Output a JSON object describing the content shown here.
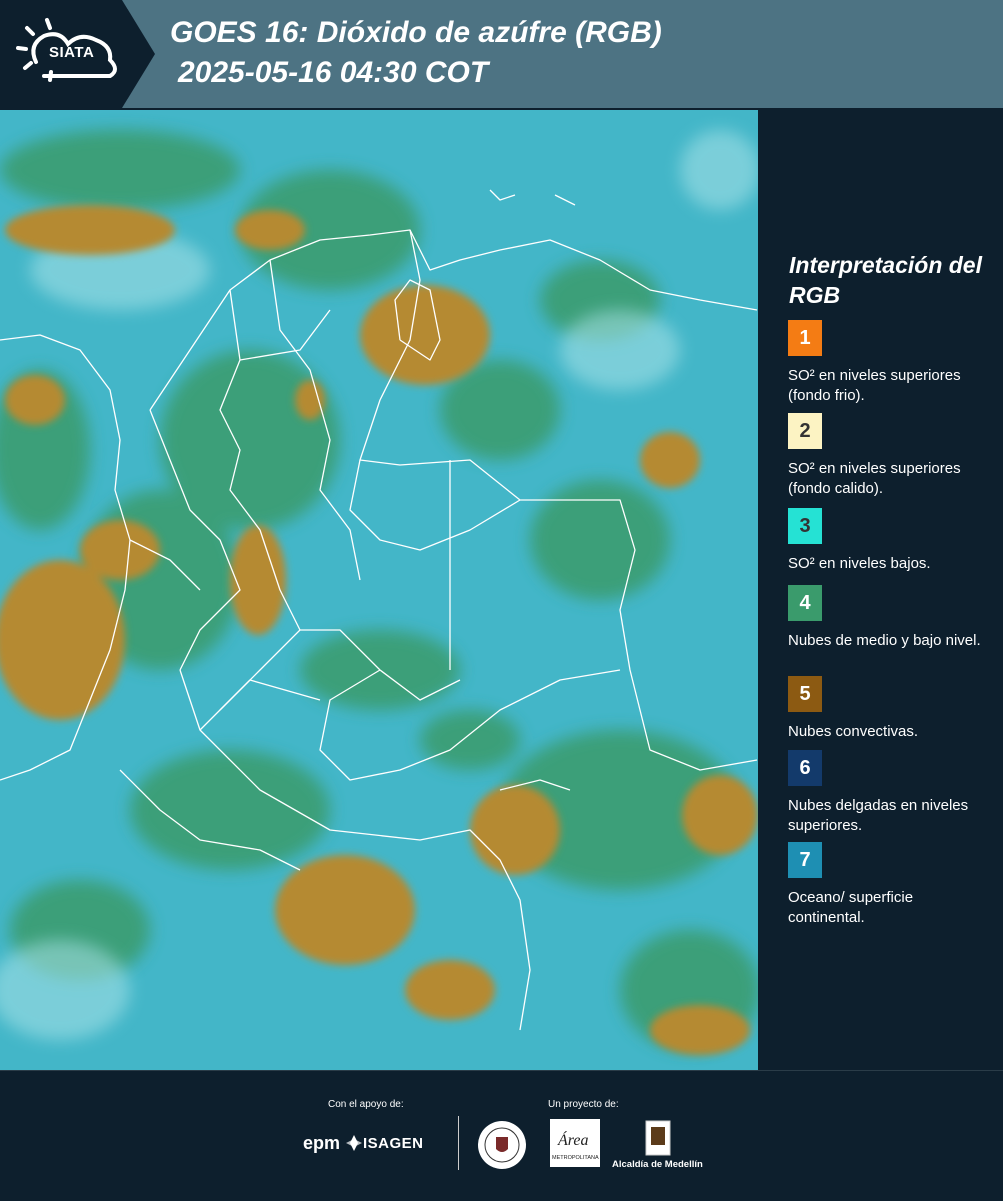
{
  "header": {
    "logo": "SIATA",
    "title_line1": "GOES 16: Dióxido de azúfre (RGB)",
    "title_line2": "2025-05-16 04:30 COT"
  },
  "legend": {
    "title": "Interpretación del RGB",
    "items": [
      {
        "num": "1",
        "color": "#f47c14",
        "num_color": "#ffffff",
        "label": "SO² en niveles superiores (fondo frio)."
      },
      {
        "num": "2",
        "color": "#fcf3c3",
        "num_color": "#333333",
        "label": "SO² en niveles superiores (fondo calido)."
      },
      {
        "num": "3",
        "color": "#25e2d4",
        "num_color": "#333333",
        "label": "SO² en niveles bajos."
      },
      {
        "num": "4",
        "color": "#3a9b6c",
        "num_color": "#ffffff",
        "label": "Nubes de medio y bajo nivel."
      },
      {
        "num": "5",
        "color": "#8c5a12",
        "num_color": "#ffffff",
        "label": "Nubes convectivas."
      },
      {
        "num": "6",
        "color": "#133a6b",
        "num_color": "#ffffff",
        "label": "Nubes delgadas en niveles superiores."
      },
      {
        "num": "7",
        "color": "#1e8fb3",
        "num_color": "#ffffff",
        "label": "Oceano/ superficie continental."
      }
    ]
  },
  "footer": {
    "support_label": "Con el apoyo de:",
    "project_label": "Un proyecto de:",
    "sponsor1": "epm",
    "sponsor2": "ISAGEN",
    "area_name": "Área",
    "area_sub": "METROPOLITANA",
    "alcaldia": "Alcaldía de Medellín"
  },
  "map": {
    "description_colors": {
      "background": "#3fb3c6",
      "low_clouds": "#3a9b6c",
      "convective": "#b98a2e",
      "borders": "#ffffff"
    }
  }
}
